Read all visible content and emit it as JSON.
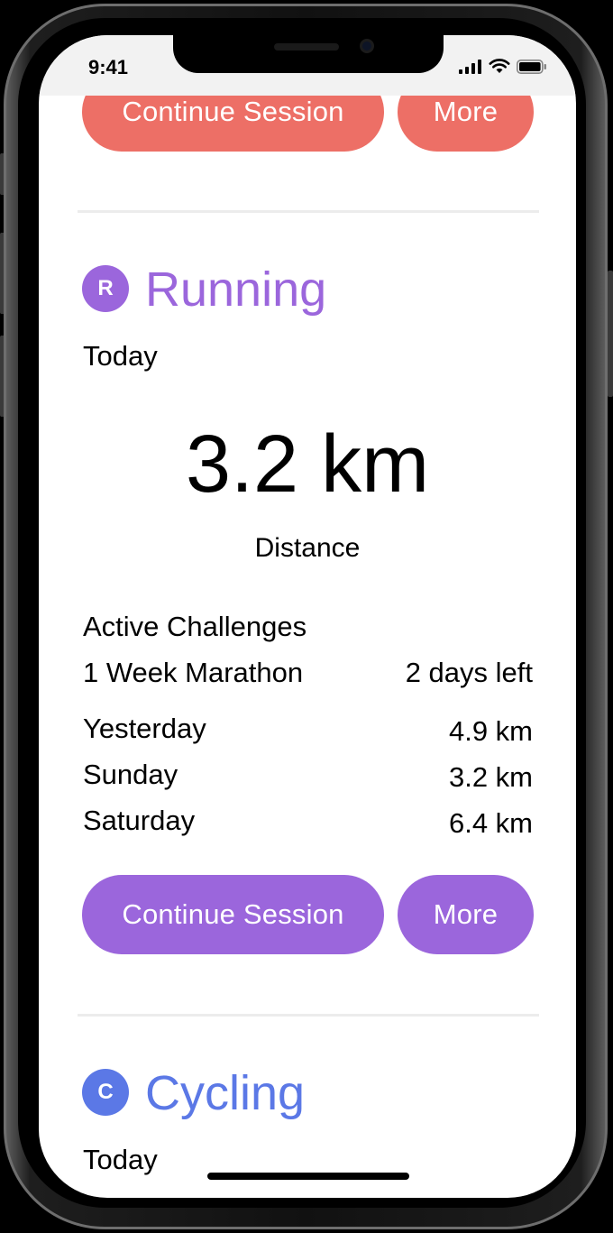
{
  "status_bar": {
    "time": "9:41"
  },
  "top_card": {
    "continue_label": "Continue Session",
    "more_label": "More",
    "accent_color": "#ed6f66"
  },
  "running": {
    "badge_letter": "R",
    "title": "Running",
    "accent_color": "#9b66dc",
    "period": "Today",
    "value": "3.2 km",
    "value_caption": "Distance",
    "challenges_heading": "Active Challenges",
    "challenge": {
      "name": "1 Week Marathon",
      "remaining": "2 days left"
    },
    "history": [
      {
        "day": "Yesterday",
        "distance": "4.9 km"
      },
      {
        "day": "Sunday",
        "distance": "3.2 km"
      },
      {
        "day": "Saturday",
        "distance": "6.4 km"
      }
    ],
    "continue_label": "Continue Session",
    "more_label": "More"
  },
  "cycling": {
    "badge_letter": "C",
    "title": "Cycling",
    "accent_color": "#5b78e6",
    "period": "Today"
  }
}
